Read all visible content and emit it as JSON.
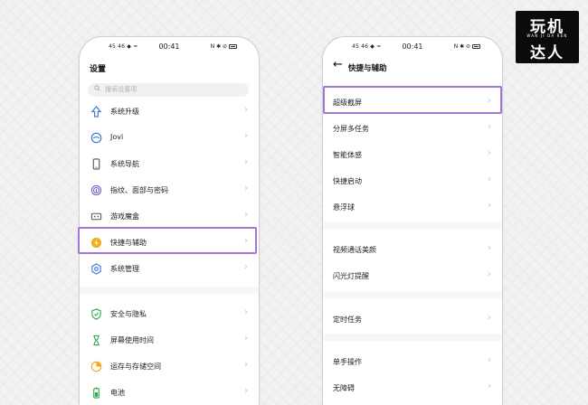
{
  "brand": {
    "line1": "玩机",
    "line2": "达人",
    "tagline": "WAN JI DA REN"
  },
  "highlight_color": "#a576d6",
  "left_phone": {
    "status": {
      "left": "45 46 ◆ ≈",
      "time": "00:41",
      "right": "N ✱ ⊘"
    },
    "title": "设置",
    "search_placeholder": "搜索设置项",
    "items": [
      {
        "label": "系统升级",
        "icon": "arrow-up-icon"
      },
      {
        "label": "Jovi",
        "icon": "jovi-icon"
      },
      {
        "label": "系统导航",
        "icon": "phone-icon"
      },
      {
        "label": "指纹、面部与密码",
        "icon": "fingerprint-icon"
      },
      {
        "label": "游戏魔盒",
        "icon": "game-box-icon"
      },
      {
        "label": "快捷与辅助",
        "icon": "shortcut-icon",
        "highlighted": true
      },
      {
        "label": "系统管理",
        "icon": "gear-icon"
      },
      {
        "label": "安全与隐私",
        "icon": "shield-icon"
      },
      {
        "label": "屏幕使用时间",
        "icon": "hourglass-icon"
      },
      {
        "label": "运存与存储空间",
        "icon": "storage-icon"
      },
      {
        "label": "电池",
        "icon": "battery-icon"
      }
    ]
  },
  "right_phone": {
    "status": {
      "left": "45 46 ◆ ≈",
      "time": "00:41",
      "right": "N ✱ ⊘"
    },
    "back_icon": "back-arrow-icon",
    "title": "快捷与辅助",
    "items": [
      {
        "label": "超级截屏",
        "highlighted": true
      },
      {
        "label": "分屏多任务"
      },
      {
        "label": "智能体感"
      },
      {
        "label": "快捷启动"
      },
      {
        "label": "悬浮球"
      },
      {
        "label": "视频通话美颜"
      },
      {
        "label": "闪光灯提醒"
      },
      {
        "label": "定时任务"
      },
      {
        "label": "单手操作"
      },
      {
        "label": "无障碍"
      }
    ]
  }
}
